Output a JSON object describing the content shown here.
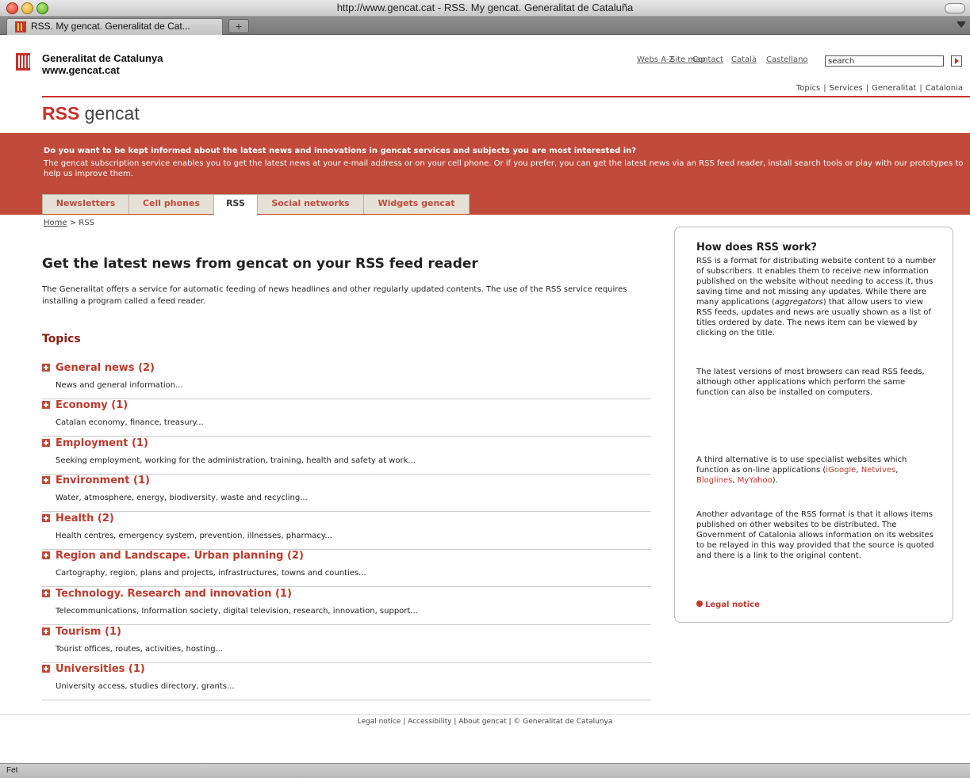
{
  "window": {
    "title": "http://www.gencat.cat - RSS. My gencat. Generalitat de Cataluña"
  },
  "browser_tab": {
    "label": "RSS. My gencat. Generalitat de Cat...",
    "new_tab": "+"
  },
  "header": {
    "brand_line1": "Generalitat de Catalunya",
    "brand_line2": "www.gencat.cat",
    "links": [
      "Webs A-Z",
      "Site map",
      "Contact",
      "Català",
      "Castellano"
    ],
    "search_value": "search",
    "nav": [
      "Topics",
      "Services",
      "Generalitat",
      "Catalonia"
    ]
  },
  "rss_title": {
    "bold": "RSS",
    "rest": " gencat"
  },
  "banner": {
    "question": "Do you want to be kept informed about the latest news and innovations in gencat services and subjects you are most interested in?",
    "description": "The gencat subscription service enables you to get the latest news at your e-mail address or on your cell phone. Or if you prefer, you can get the latest news via an RSS feed reader, install search tools or play with our prototypes to help us improve them."
  },
  "tabs": [
    "Newsletters",
    "Cell phones",
    "RSS",
    "Social networks",
    "Widgets gencat"
  ],
  "breadcrumb": {
    "home": "Home",
    "separator": " > ",
    "current": "RSS"
  },
  "main": {
    "heading": "Get the latest news from gencat on your RSS feed reader",
    "intro": "The Generalitat offers a service for automatic feeding of news headlines and other regularly updated contents. The use of the RSS service requires installing a program called a feed reader.",
    "topics_heading": "Topics",
    "topics": [
      {
        "title": "General news (2)",
        "desc": "News and general information..."
      },
      {
        "title": "Economy (1)",
        "desc": "Catalan economy, finance, treasury..."
      },
      {
        "title": "Employment (1)",
        "desc": "Seeking employment, working for the administration, training, health and safety at work..."
      },
      {
        "title": "Environment (1)",
        "desc": "Water, atmosphere, energy, biodiversity, waste and recycling..."
      },
      {
        "title": "Health (2)",
        "desc": "Health centres, emergency system, prevention, illnesses, pharmacy..."
      },
      {
        "title": "Region and Landscape. Urban planning (2)",
        "desc": "Cartography, region, plans and projects, infrastructures, towns and counties..."
      },
      {
        "title": "Technology. Research and innovation (1)",
        "desc": "Telecommunications, Information society, digital television, research, innovation, support..."
      },
      {
        "title": "Tourism (1)",
        "desc": "Tourist offices, routes, activities, hosting..."
      },
      {
        "title": "Universities (1)",
        "desc": "University access, studies directory, grants..."
      }
    ]
  },
  "sidebar": {
    "heading": "How does RSS work?",
    "p1_a": "RSS is a format for distributing website content to a number of subscribers. It enables them to receive new information published on the website without needing to access it, thus saving time and not missing any updates. While there are many applications (",
    "p1_em": "aggregators",
    "p1_b": ") that allow users to view RSS feeds, updates and news are usually shown as a list of titles ordered by date. The news item can be viewed by clicking on the title.",
    "p2": "The latest versions of most browsers can read RSS feeds, although other applications which perform the same function can also be installed on computers.",
    "p3_a": "A third alternative is to use specialist websites which function as on-line applications (",
    "p3_links": [
      "iGoogle",
      "Netvives",
      "Bloglines",
      "MyYahoo"
    ],
    "p3_b": ").",
    "p4": "Another advantage of the RSS format is that it allows items published on other websites to be distributed. The Government of Catalonia allows information on its websites to be relayed in this way provided that the source is quoted and there is a link to the original content.",
    "legal": "Legal notice"
  },
  "footer": {
    "text": "Legal notice | Accessibility | About gencat | © Generalitat de Catalunya"
  },
  "status": {
    "text": "Fet"
  },
  "colors": {
    "accent": "#c8302a",
    "banner": "#c24a3a",
    "topic_heading": "#8a1c10"
  }
}
